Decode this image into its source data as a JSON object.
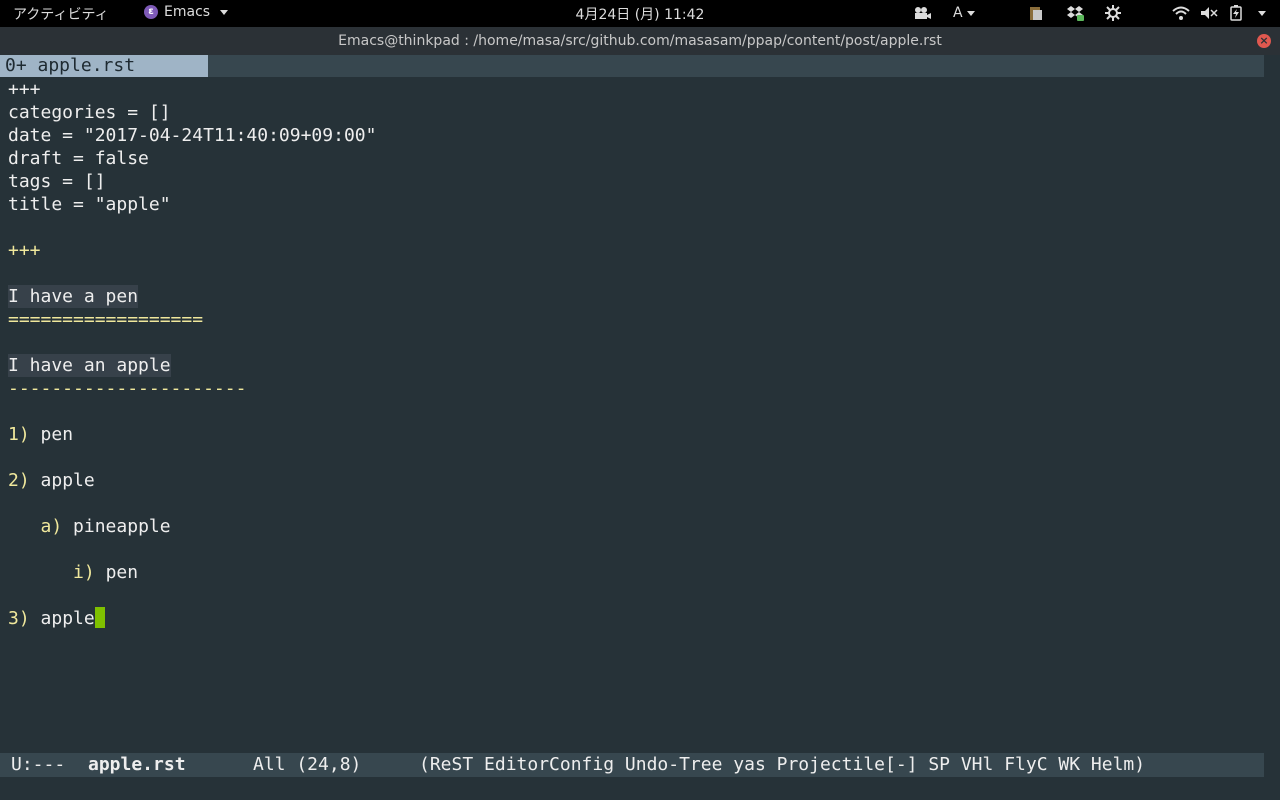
{
  "topbar": {
    "activities": "アクティビティ",
    "app_name": "Emacs",
    "clock": "4月24日 (月) 11:42",
    "input_method": "A"
  },
  "window": {
    "title": "Emacs@thinkpad : /home/masa/src/github.com/masasam/ppap/content/post/apple.rst"
  },
  "tab": {
    "label": "0+ apple.rst"
  },
  "buffer": {
    "lines": [
      "+++",
      "categories = []",
      "date = \"2017-04-24T11:40:09+09:00\"",
      "draft = false",
      "tags = []",
      "title = \"apple\"",
      "",
      "+++",
      "",
      "I have a pen",
      "==================",
      "",
      "I have an apple",
      "----------------------",
      "",
      "1)",
      "pen",
      "2)",
      "apple",
      "a)",
      "pineapple",
      "i)",
      "pen",
      "3)",
      "apple"
    ],
    "list": [
      {
        "marker": "1)",
        "text": "pen"
      },
      {
        "marker": "2)",
        "text": "apple"
      },
      {
        "marker": "a)",
        "text": "pineapple"
      },
      {
        "marker": "i)",
        "text": "pen"
      },
      {
        "marker": "3)",
        "text": "apple"
      }
    ]
  },
  "modeline": {
    "status": "U:---",
    "buffer_name": "apple.rst",
    "position": "All (24,8)",
    "modes": "(ReST EditorConfig Undo-Tree yas Projectile[-] SP VHl FlyC WK Helm)"
  },
  "colors": {
    "background": "#263238",
    "modeline": "#37474f",
    "tab_active": "#9fb4c6",
    "cursor": "#7fc000",
    "markup_yellow": "#f0e89c"
  }
}
